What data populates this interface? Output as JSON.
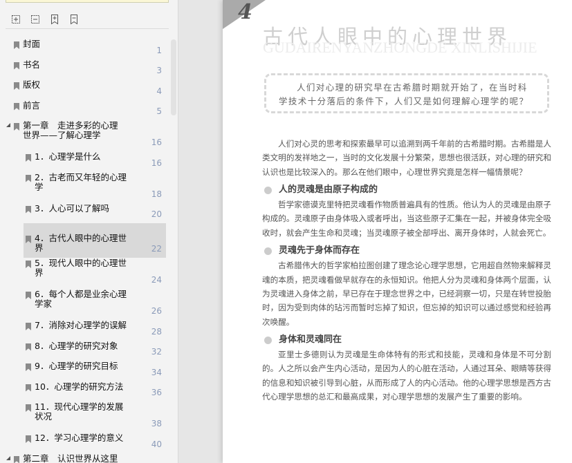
{
  "sidebar": {
    "toolbar": [
      "expand-all-icon",
      "collapse-all-icon",
      "add-bookmark-icon",
      "remove-bookmark-icon"
    ],
    "items": [
      {
        "label": "封面",
        "page": "1"
      },
      {
        "label": "书名",
        "page": "3"
      },
      {
        "label": "版权",
        "page": "4"
      },
      {
        "label": "前言",
        "page": "5"
      },
      {
        "label": "第一章　走进多彩的心理世界——了解心理学",
        "page": "16"
      },
      {
        "label": "1．心理学是什么",
        "page": "16"
      },
      {
        "label": "2．古老而又年轻的心理学",
        "page": "18"
      },
      {
        "label": "3．人心可以了解吗",
        "page": "20"
      },
      {
        "label": "4．古代人眼中的心理世界",
        "page": "22"
      },
      {
        "label": "5．现代人眼中的心理世界",
        "page": "24"
      },
      {
        "label": "6．每个人都是业余心理学家",
        "page": "26"
      },
      {
        "label": "7．消除对心理学的误解",
        "page": "28"
      },
      {
        "label": "8．心理学的研究对象",
        "page": "32"
      },
      {
        "label": "9．心理学的研究目标",
        "page": "34"
      },
      {
        "label": "10．心理学的研究方法",
        "page": "36"
      },
      {
        "label": "11．现代心理学的发展状况",
        "page": "38"
      },
      {
        "label": "12．学习心理学的意义",
        "page": "40"
      },
      {
        "label": "第二章　认识世界从这里开",
        "page": ""
      }
    ]
  },
  "page": {
    "chapter_number": "4",
    "title": "古代人眼中的心理世界",
    "pinyin": "GUDAIRENYANZHONGDE XINLISHIJIE",
    "intro": "人们对心理的研究早在古希腊时期就开始了，在当时科学技术十分落后的条件下，人们又是如何理解心理学的呢？",
    "p0": "人们对心灵的思考和探索最早可以追溯到两千年前的古希腊时期。古希腊是人类文明的发祥地之一，当时的文化发展十分繁荣，思想也很活跃，对心理的研究和认识也是比较深入的。那么在他们眼中，心理世界究竟是怎样一幅情景呢？",
    "h1": "人的灵魂是由原子构成的",
    "p1": "哲学家德谟克里特把灵魂看作物质普遍具有的性质。他认为人的灵魂是由原子构成的。灵魂原子由身体吸入或者呼出，当这些原子汇集在一起，并被身体完全吸收时，就会产生生命和灵魂；当灵魂原子被全部呼出、离开身体时，人就会死亡。",
    "h2": "灵魂先于身体而存在",
    "p2": "古希腊伟大的哲学家柏拉图创建了理念论心理学思想，它用超自然物来解释灵魂的本质，把灵魂看做早就存在的永恒知识。他把人分为灵魂和身体两个层面，认为灵魂进入身体之前，早已存在于理念世界之中，已经洞察一切，只是在转世投胎时，因为受到肉体的玷污而暂时忘掉了知识，但忘掉的知识可以通过感觉和经验再次唤醒。",
    "h3": "身体和灵魂同在",
    "p3": "亚里士多德则认为灵魂是生命体特有的形式和技能，灵魂和身体是不可分割的。人之所以会产生内心活动，是因为人的心脏在活动，人通过耳朵、眼睛等获得的信息和知识被引导到心脏，从而形成了人的内心活动。他的心理学思想是西方古代心理学思想的总汇和最高成果，对心理学思想的发展产生了重要的影响。"
  }
}
